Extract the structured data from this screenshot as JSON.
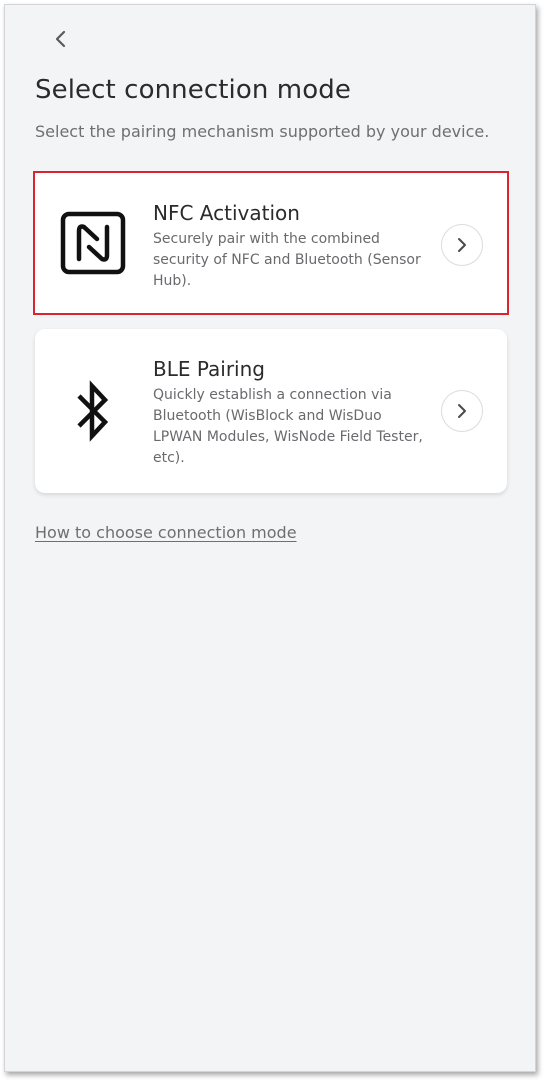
{
  "header": {
    "back_icon": "chevron-left-icon",
    "title": "Select connection mode",
    "subtitle": "Select the pairing mechanism supported by your device."
  },
  "options": [
    {
      "title": "NFC Activation",
      "description": "Securely pair with the combined security of NFC and Bluetooth (Sensor Hub).",
      "icon": "nfc-icon",
      "action_icon": "chevron-right-icon",
      "selected": true
    },
    {
      "title": "BLE Pairing",
      "description": "Quickly establish a connection via Bluetooth (WisBlock and WisDuo LPWAN Modules, WisNode Field Tester, etc).",
      "icon": "bluetooth-icon",
      "action_icon": "chevron-right-icon",
      "selected": false
    }
  ],
  "help_link": "How to choose connection mode",
  "colors": {
    "background": "#f3f4f6",
    "card": "#ffffff",
    "selection_outline": "#d8252f",
    "title_text": "#2b2b2b",
    "secondary_text": "#6f6f72"
  }
}
